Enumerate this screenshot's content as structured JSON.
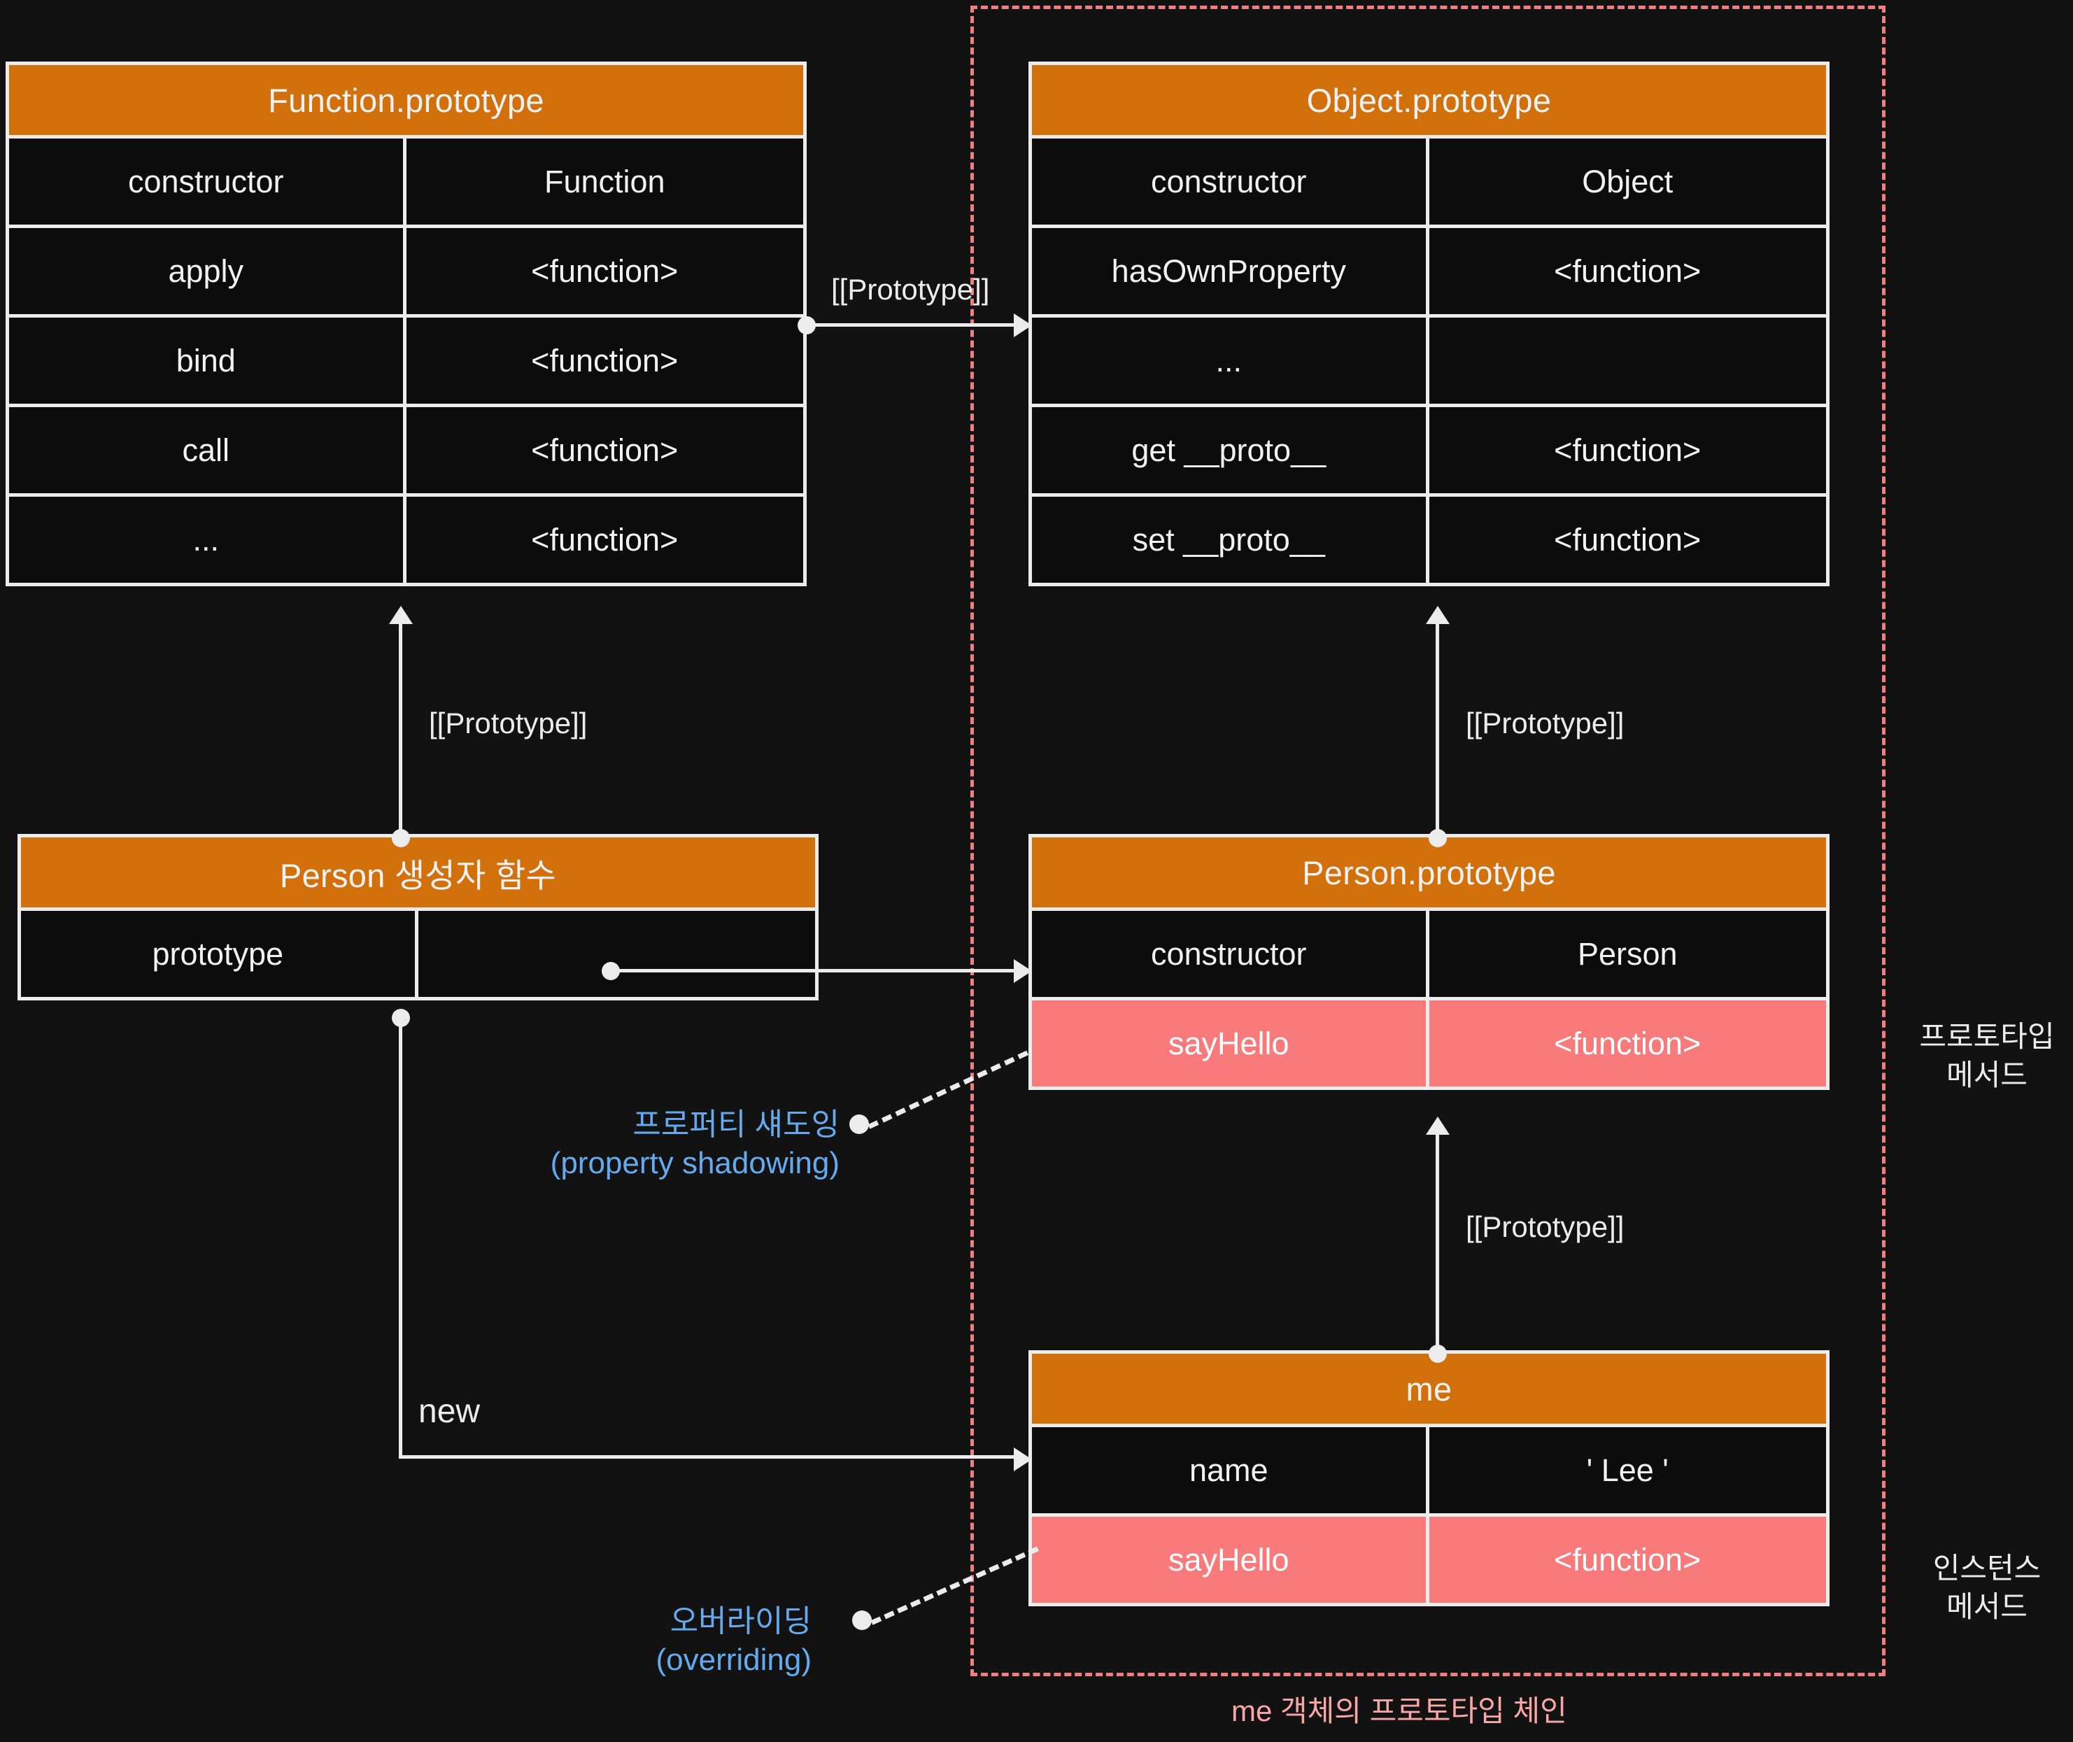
{
  "diagram": {
    "caption": "me 객체의 프로토타입 체인",
    "boxes": {
      "function_prototype": {
        "title": "Function.prototype",
        "rows": [
          {
            "key": "constructor",
            "value": "Function"
          },
          {
            "key": "apply",
            "value": "<function>"
          },
          {
            "key": "bind",
            "value": "<function>"
          },
          {
            "key": "call",
            "value": "<function>"
          },
          {
            "key": "...",
            "value": "<function>"
          }
        ]
      },
      "object_prototype": {
        "title": "Object.prototype",
        "rows": [
          {
            "key": "constructor",
            "value": "Object"
          },
          {
            "key": "hasOwnProperty",
            "value": "<function>"
          },
          {
            "key": "...",
            "value": ""
          },
          {
            "key": "get __proto__",
            "value": "<function>"
          },
          {
            "key": "set __proto__",
            "value": "<function>"
          }
        ]
      },
      "person_constructor": {
        "title": "Person 생성자 함수",
        "rows": [
          {
            "key": "prototype",
            "value": ""
          }
        ]
      },
      "person_prototype": {
        "title": "Person.prototype",
        "rows": [
          {
            "key": "constructor",
            "value": "Person"
          },
          {
            "key": "sayHello",
            "value": "<function>"
          }
        ]
      },
      "me": {
        "title": "me",
        "rows": [
          {
            "key": "name",
            "value": "' Lee '"
          },
          {
            "key": "sayHello",
            "value": "<function>"
          }
        ]
      }
    },
    "edges": {
      "fnproto_to_objproto": "[[Prototype]]",
      "person_to_fnproto": "[[Prototype]]",
      "personproto_to_objproto": "[[Prototype]]",
      "me_to_personproto": "[[Prototype]]",
      "new_label": "new"
    },
    "annotations": {
      "property_shadowing_ko": "프로퍼티 섀도잉",
      "property_shadowing_en": "(property shadowing)",
      "overriding_ko": "오버라이딩",
      "overriding_en": "(overriding)"
    },
    "side_labels": {
      "prototype_method_line1": "프로토타입",
      "prototype_method_line2": "메서드",
      "instance_method_line1": "인스턴스",
      "instance_method_line2": "메서드"
    },
    "colors": {
      "background": "#121212",
      "header": "#d2700c",
      "border": "#ececec",
      "highlight": "#f97a7a",
      "annotation": "#66aaee",
      "chain": "#f08080",
      "caption": "#f9a6a6"
    }
  }
}
